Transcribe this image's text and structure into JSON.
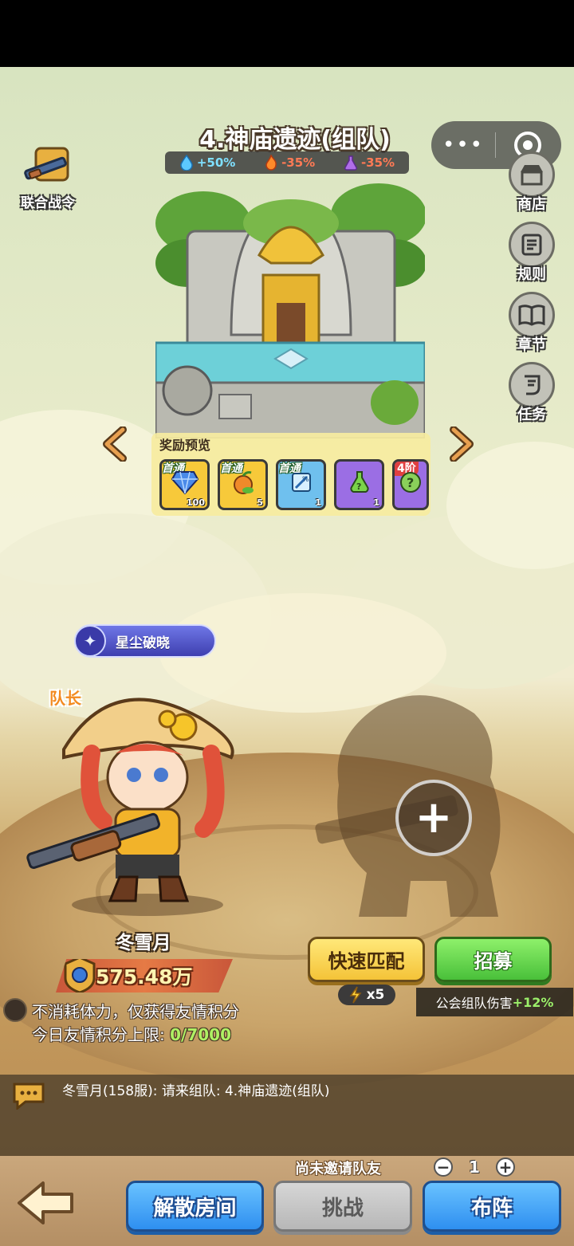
{
  "level": {
    "title": "4.神庙遗迹(组队)",
    "buffs": [
      {
        "icon": "water-drop-icon",
        "value": "+50%",
        "color": "#7fe0ff"
      },
      {
        "icon": "fire-icon",
        "value": "-35%",
        "color": "#ff7a55"
      },
      {
        "icon": "poison-flask-icon",
        "value": "-35%",
        "color": "#ff7a55"
      }
    ]
  },
  "miniapp_capsule": {
    "more": "•••",
    "close_icon": "circle-target-icon"
  },
  "battle_pass": {
    "label": "联合战令",
    "icon": "rifle-chest-icon"
  },
  "side_menu": [
    {
      "label": "商店",
      "icon": "shop-icon"
    },
    {
      "label": "规则",
      "icon": "rules-icon"
    },
    {
      "label": "章节",
      "icon": "book-icon"
    },
    {
      "label": "任务",
      "icon": "quest-icon"
    }
  ],
  "rewards": {
    "title": "奖励预览",
    "items": [
      {
        "tag": "首通",
        "count": "100",
        "icon": "diamond-icon",
        "bg": "#f7c93a"
      },
      {
        "tag": "首通",
        "count": "5",
        "icon": "fruit-icon",
        "bg": "#f7c93a"
      },
      {
        "tag": "首通",
        "count": "1",
        "icon": "scroll-icon",
        "bg": "#6fc0ee"
      },
      {
        "tag": "",
        "count": "1",
        "icon": "potion-icon",
        "bg": "#9b6ee4"
      },
      {
        "tag": "4阶",
        "count": "",
        "icon": "mystery-icon",
        "bg": "#9b6ee4"
      }
    ]
  },
  "player": {
    "title_badge": "星尘破晓",
    "role": "队长",
    "name": "冬雪月",
    "power": "575.48万"
  },
  "info": {
    "line1": "不消耗体力，仅获得友情积分",
    "line2_prefix": "今日友情积分上限: ",
    "line2_value": "0/7000"
  },
  "buttons": {
    "quick_match": "快速匹配",
    "recruit": "招募",
    "energy_cost": "x5",
    "guild_bonus_label": "公会组队伤害",
    "guild_bonus_value": "+12%",
    "add_teammate": "+"
  },
  "chat": {
    "message": "冬雪月(158服): 请来组队: 4.神庙遗迹(组队)"
  },
  "footer": {
    "not_invited": "尚未邀请队友",
    "stepper_value": "1",
    "dissolve": "解散房间",
    "challenge": "挑战",
    "formation": "布阵"
  }
}
